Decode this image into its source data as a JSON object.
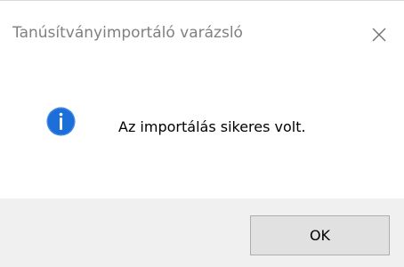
{
  "window": {
    "title": "Tanúsítványimportáló varázsló",
    "close_icon": "close-icon"
  },
  "content": {
    "icon": "info-icon",
    "icon_color": "#1c6fd8",
    "message": "Az importálás sikeres volt."
  },
  "footer": {
    "ok_label": "OK",
    "background": "#f0f0f0"
  }
}
